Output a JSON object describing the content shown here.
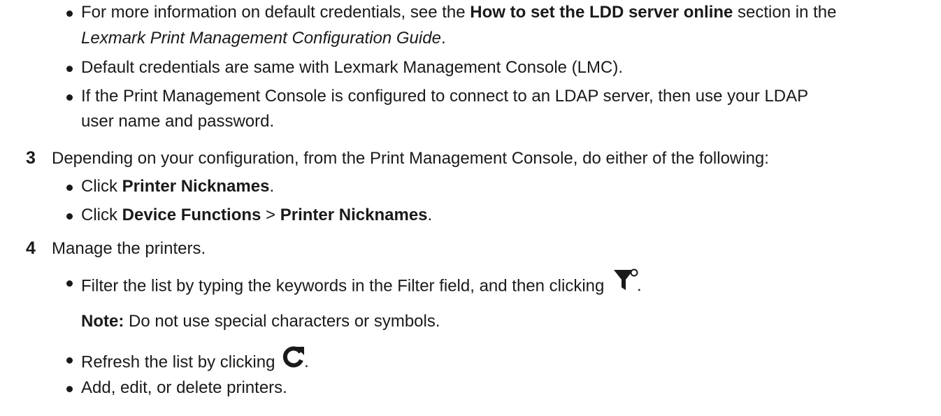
{
  "intro_bullets": [
    {
      "pre": "For more information on default credentials, see the ",
      "bold": "How to set the LDD server online",
      "post": " section in the",
      "line2_italic": "Lexmark Print Management Configuration Guide",
      "line2_post": "."
    },
    {
      "text": "Default credentials are same with Lexmark Management Console (LMC)."
    },
    {
      "line1": "If the Print Management Console is configured to connect to an LDAP server, then use your LDAP",
      "line2": "user name and password."
    }
  ],
  "step3": {
    "number": "3",
    "text": "Depending on your configuration, from the Print Management Console, do either of the following:",
    "bullets": [
      {
        "pre": "Click ",
        "bold1": "Printer Nicknames",
        "post": "."
      },
      {
        "pre": "Click ",
        "bold1": "Device Functions",
        "sep": " > ",
        "bold2": "Printer Nicknames",
        "post": "."
      }
    ]
  },
  "step4": {
    "number": "4",
    "text": "Manage the printers.",
    "filter_bullet": "Filter the list by typing the keywords in the Filter field, and then clicking",
    "filter_post": ".",
    "note_label": "Note:",
    "note_text": " Do not use special characters or symbols.",
    "refresh_bullet": "Refresh the list by clicking",
    "refresh_post": ".",
    "last_bullet": "Add, edit, or delete printers."
  },
  "icons": {
    "filter": "filter-icon",
    "refresh": "refresh-icon"
  }
}
